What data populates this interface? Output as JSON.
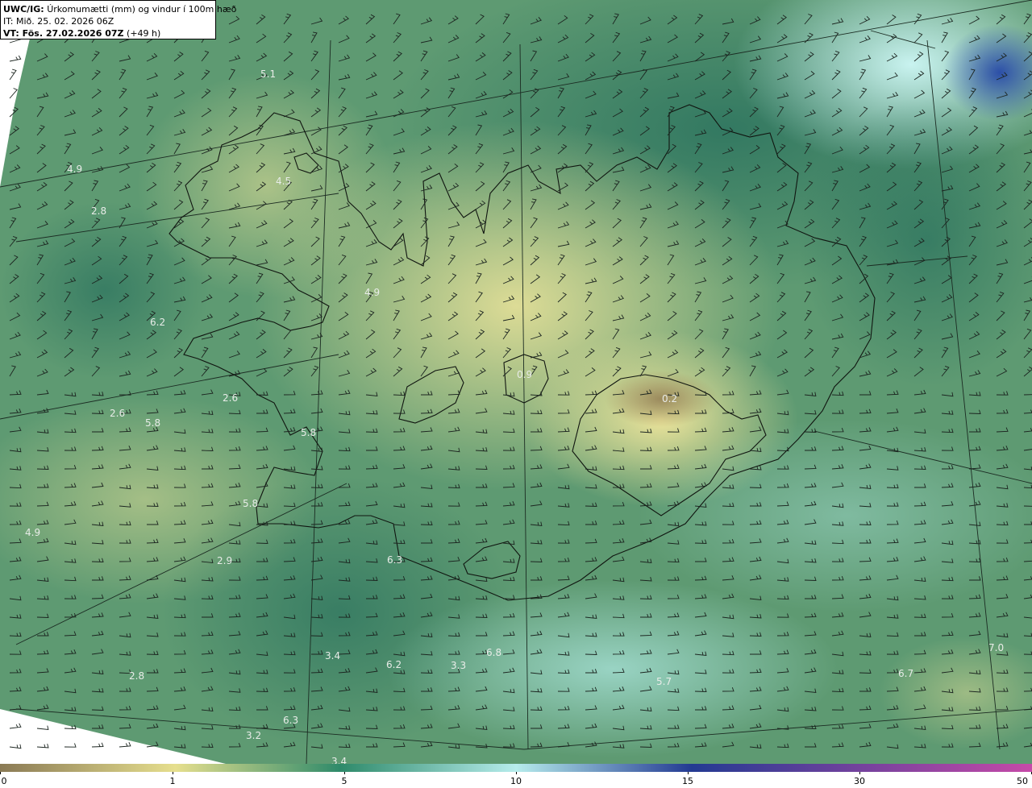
{
  "header": {
    "model_prefix": "UWC/IG:",
    "title": "Úrkomumætti (mm) og vindur í 100m hæð",
    "init_time": "IT: Mið. 25. 02. 2026 06Z",
    "valid_prefix": "VT: Fös. 27.02.2026 07Z",
    "valid_suffix": "(+49 h)"
  },
  "value_labels": [
    "5.1",
    "4.9",
    "2.8",
    "4.5",
    "4.9",
    "6.2",
    "2.6",
    "2.6",
    "5.8",
    "5.8",
    "0.9",
    "0.2",
    "5.8",
    "4.9",
    "2.9",
    "6.3",
    "3.4",
    "6.2",
    "3.3",
    "6.8",
    "2.8",
    "5.7",
    "7.0",
    "6.7",
    "6.3",
    "3.2",
    "3.4"
  ],
  "legend": {
    "ticks": [
      "0",
      "1",
      "5",
      "10",
      "15",
      "30",
      "50"
    ]
  },
  "colors": {
    "dry": "#8a7a55",
    "low": "#e6df8e",
    "mid": "#2e8a6a",
    "high": "#b6ecec",
    "very_high": "#233a92",
    "extreme": "#c64aa8"
  }
}
